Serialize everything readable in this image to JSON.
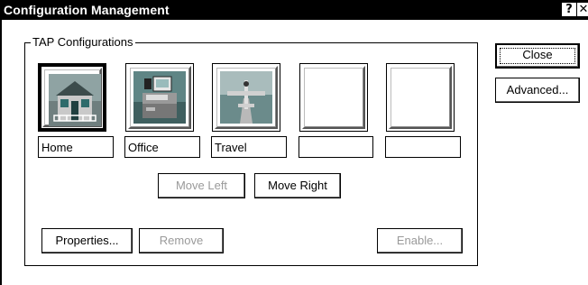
{
  "window": {
    "title": "Configuration Management",
    "help_button": "?",
    "close_button": "✕"
  },
  "group": {
    "label": "TAP Configurations"
  },
  "configurations": [
    {
      "name": "Home",
      "icon": "house-icon",
      "selected": true
    },
    {
      "name": "Office",
      "icon": "office-desk-icon",
      "selected": false
    },
    {
      "name": "Travel",
      "icon": "airplane-icon",
      "selected": false
    },
    {
      "name": "",
      "icon": "empty-slot",
      "selected": false
    },
    {
      "name": "",
      "icon": "empty-slot",
      "selected": false
    }
  ],
  "buttons": {
    "move_left": "Move Left",
    "move_right": "Move Right",
    "properties": "Properties...",
    "remove": "Remove",
    "enable": "Enable...",
    "close": "Close",
    "advanced": "Advanced..."
  },
  "colors": {
    "titlebar": "#000000",
    "disabled_text": "#9a9a9a",
    "icon_teal": "#2e6b6b",
    "icon_grey": "#8a8a8a"
  }
}
